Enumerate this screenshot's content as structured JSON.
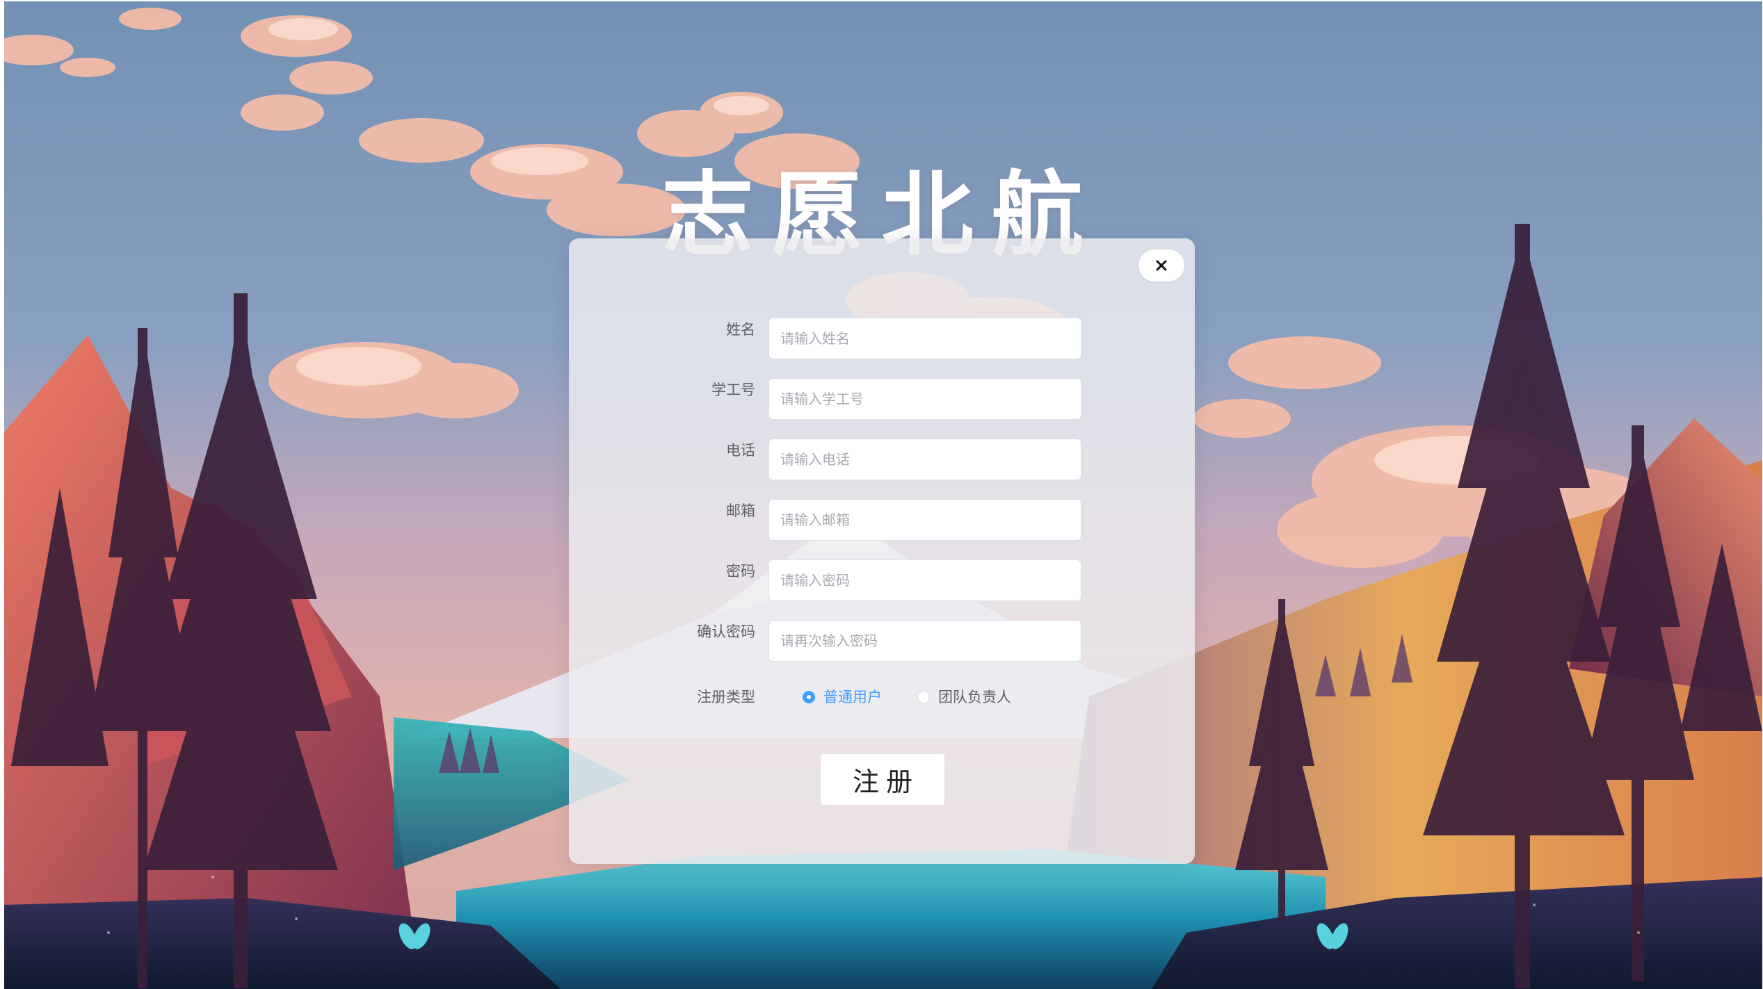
{
  "app": {
    "title": "志愿北航"
  },
  "dialog": {
    "close_icon": "close-icon",
    "fields": [
      {
        "label": "姓名",
        "placeholder": "请输入姓名",
        "value": ""
      },
      {
        "label": "学工号",
        "placeholder": "请输入学工号",
        "value": ""
      },
      {
        "label": "电话",
        "placeholder": "请输入电话",
        "value": ""
      },
      {
        "label": "邮箱",
        "placeholder": "请输入邮箱",
        "value": ""
      },
      {
        "label": "密码",
        "placeholder": "请输入密码",
        "value": ""
      },
      {
        "label": "确认密码",
        "placeholder": "请再次输入密码",
        "value": ""
      }
    ],
    "register_type": {
      "label": "注册类型",
      "options": [
        {
          "label": "普通用户",
          "checked": true
        },
        {
          "label": "团队负责人",
          "checked": false
        }
      ]
    },
    "submit_label": "注册"
  },
  "colors": {
    "accent": "#409eff",
    "panel": "#ececf0",
    "sky_top": "#7a99b8",
    "cloud": "#f4b9a8"
  }
}
